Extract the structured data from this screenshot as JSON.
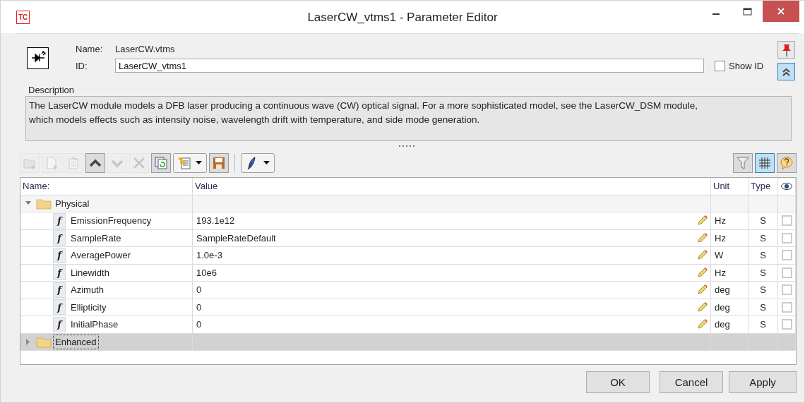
{
  "window": {
    "title": "LaserCW_vtms1 - Parameter Editor",
    "logo": "TC"
  },
  "header": {
    "name_label": "Name:",
    "name": "LaserCW.vtms",
    "id_label": "ID:",
    "id": "LaserCW_vtms1",
    "show_id": {
      "label": "Show ID",
      "checked": false
    },
    "pin": {
      "pressed": false
    },
    "collapse": {
      "pressed": true
    }
  },
  "description": {
    "label": "Description",
    "text": "The LaserCW module models a DFB laser producing a continuous wave (CW) optical signal. For a more sophisticated model, see the LaserCW_DSM module, which models effects such as intensity noise, wavelength drift with temperature, and side mode generation."
  },
  "toolbar": {
    "left": [
      {
        "kind": "button",
        "disabled": true,
        "pressed": false
      },
      {
        "kind": "button",
        "disabled": true,
        "pressed": false
      },
      {
        "kind": "button",
        "disabled": true,
        "pressed": false
      },
      {
        "kind": "button",
        "disabled": false,
        "pressed": true
      },
      {
        "kind": "button",
        "disabled": true,
        "pressed": false
      },
      {
        "kind": "button",
        "disabled": true,
        "pressed": false
      },
      {
        "kind": "button",
        "disabled": false,
        "pressed": true
      },
      {
        "kind": "dropdown",
        "disabled": false
      },
      {
        "kind": "button",
        "disabled": false,
        "pressed": true
      },
      {
        "kind": "separator"
      },
      {
        "kind": "dropdown",
        "disabled": false
      }
    ],
    "right": [
      {
        "disabled": false,
        "pressed": true
      },
      {
        "disabled": false,
        "pressed": true
      },
      {
        "disabled": false,
        "pressed": true
      }
    ]
  },
  "table": {
    "columns": [
      "Name:",
      "Value",
      "Unit",
      "Type"
    ],
    "groups": [
      {
        "name": "Physical",
        "expanded": true,
        "selected": false,
        "children": [
          {
            "badge": "f",
            "name": "EmissionFrequency",
            "value": "193.1e12",
            "unit": "Hz",
            "type": "S",
            "checked": false
          },
          {
            "badge": "f",
            "name": "SampleRate",
            "value": "SampleRateDefault",
            "unit": "Hz",
            "type": "S",
            "checked": false
          },
          {
            "badge": "f",
            "name": "AveragePower",
            "value": "1.0e-3",
            "unit": "W",
            "type": "S",
            "checked": false
          },
          {
            "badge": "f",
            "name": "Linewidth",
            "value": "10e6",
            "unit": "Hz",
            "type": "S",
            "checked": false
          },
          {
            "badge": "f",
            "name": "Azimuth",
            "value": "0",
            "unit": "deg",
            "type": "S",
            "checked": false
          },
          {
            "badge": "f",
            "name": "Ellipticity",
            "value": "0",
            "unit": "deg",
            "type": "S",
            "checked": false
          },
          {
            "badge": "f",
            "name": "InitialPhase",
            "value": "0",
            "unit": "deg",
            "type": "S",
            "checked": false
          }
        ]
      },
      {
        "name": "Enhanced",
        "expanded": false,
        "selected": true
      }
    ]
  },
  "buttons": [
    "OK",
    "Cancel",
    "Apply"
  ]
}
